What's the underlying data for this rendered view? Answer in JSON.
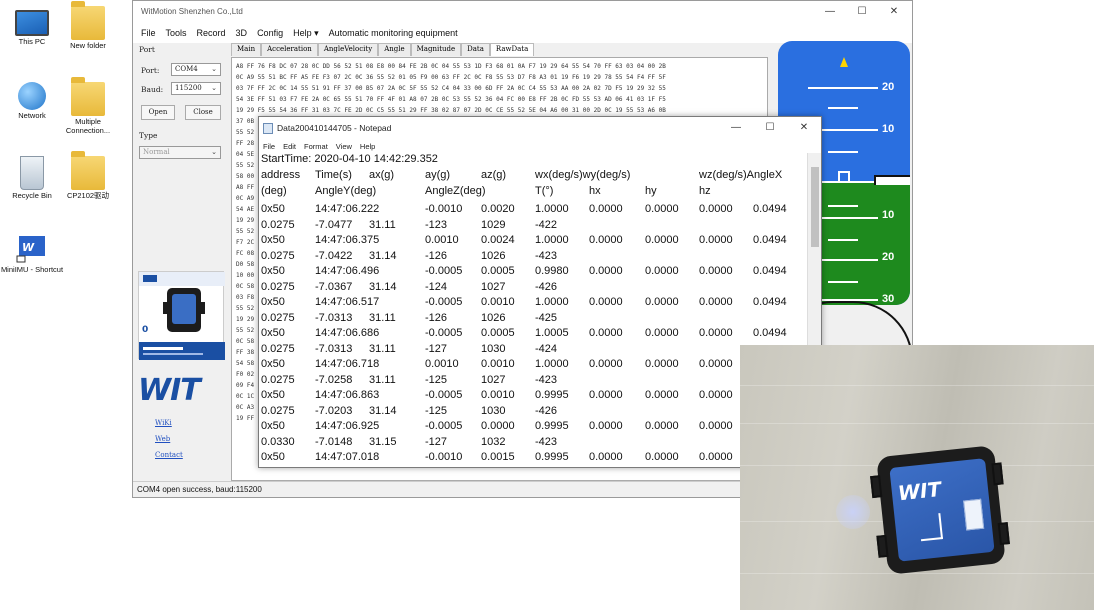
{
  "desktop": {
    "icons": [
      {
        "label": "This PC",
        "icon": "computer-icon"
      },
      {
        "label": "New folder",
        "icon": "folder-icon"
      },
      {
        "label": "Network",
        "icon": "network-icon"
      },
      {
        "label": "Multiple Connection...",
        "icon": "folder-icon"
      },
      {
        "label": "Recycle Bin",
        "icon": "recycle-bin-icon"
      },
      {
        "label": "CP2102驱动",
        "icon": "folder-icon"
      },
      {
        "label": "MiniIMU - Shortcut",
        "icon": "app-shortcut-icon"
      }
    ]
  },
  "app": {
    "title": "WitMotion Shenzhen Co.,Ltd",
    "menu": [
      "File",
      "Tools",
      "Record",
      "3D",
      "Config",
      "Help ▾",
      "Automatic monitoring equipment"
    ],
    "left": {
      "port_section": "Port",
      "port_label": "Port:",
      "port_value": "COM4",
      "baud_label": "Baud:",
      "baud_value": "115200",
      "open_label": "Open",
      "close_label": "Close",
      "type_section": "Type",
      "type_value": "Normal",
      "links": [
        "WiKi",
        "Web",
        "Contact"
      ],
      "logo_text": "WIT"
    },
    "tabs": [
      "Main",
      "Acceleration",
      "AngleVelocity",
      "Angle",
      "Magnitude",
      "Data",
      "RawData"
    ],
    "active_tab": "RawData",
    "hex_lines": [
      "A8 FF 76 F8 DC 07 28 0C DD 56 52 51 08 E8 00 84 FE 2B 0C 04 55 53 1D F3 68 01 0A F7 19 29 64 55 54 70 FF 63 03 04 00 2B",
      "0C A9 55 51 BC FF A5 FE F3 07 2C 0C 36 55 52 01 05 F9 00 63 FF 2C 0C F8 55 53 D7 F8 A3 01 19 F6 19 29 78 55 54 F4 FF 5F",
      "03 7F FF 2C 0C 14 55 51 91 FF 37 00 B5 07 2A 0C 5F 55 52 C4 04 33 00 6D FF 2A 0C C4 55 53 AA 00 2A 02 7D F5 19 29 32 55",
      "54 3E FF 51 03 F7 FE 2A 0C 65 55 51 70 FF 4F 01 A8 07 2B 0C 53 55 52 36 04 FC 00 E8 FF 2B 0C FD 55 53 AD 06 41 03 1F F5",
      "19 29 F5 55 54 36 FF 31 03 7C FE 2D 0C C5 55 51 29 FF 38 02 87 07 2D 0C CE 55 52 5E 04 A6 00 31 00 2D 0C 19 55 53 A6 0B",
      "37 0B",
      "55 52",
      "FF 28",
      "04 5E",
      "55 52",
      "58 00",
      "A8 FF",
      "0C A9",
      "54 AE",
      "19 29",
      "55 52",
      "F7 2C",
      "FC 08",
      "D0 58",
      "10 00",
      "0C 58",
      "03 F8",
      "55 52",
      "19 29",
      "55 52",
      "0C 58",
      "FF 38",
      "54 58",
      "F0 02",
      "09 F4",
      "0C 1C",
      "0C A3",
      "19 FF"
    ],
    "status": "COM4 open success, baud:115200",
    "attitude": {
      "pitch_labels_top": [
        "20",
        "10"
      ],
      "pitch_labels_bottom": [
        "10",
        "20",
        "30"
      ]
    }
  },
  "notepad": {
    "title": "Data200410144705 - Notepad",
    "menu": [
      "File",
      "Edit",
      "Format",
      "View",
      "Help"
    ],
    "start_time": "StartTime: 2020-04-10 14:42:29.352",
    "header1": [
      "address",
      "Time(s)",
      "ax(g)",
      "ay(g)",
      "az(g)",
      "wx(deg/s)wy(deg/s)",
      "wz(deg/s)AngleX"
    ],
    "header2": [
      "(deg)",
      "AngleY(deg)",
      "AngleZ(deg)",
      "T(°)",
      "hx",
      "hy",
      "hz"
    ],
    "rows": [
      {
        "a": [
          "0x50",
          "14:47:06.222",
          "-0.0010",
          "0.0020",
          "1.0000",
          "0.0000",
          "0.0000",
          "0.0000",
          "0.0494"
        ],
        "b": [
          "0.0275",
          "-7.0477",
          "31.11",
          "-123",
          "1029",
          "-422"
        ]
      },
      {
        "a": [
          "0x50",
          "14:47:06.375",
          "0.0010",
          "0.0024",
          "1.0000",
          "0.0000",
          "0.0000",
          "0.0000",
          "0.0494"
        ],
        "b": [
          "0.0275",
          "-7.0422",
          "31.14",
          "-126",
          "1026",
          "-423"
        ]
      },
      {
        "a": [
          "0x50",
          "14:47:06.496",
          "-0.0005",
          "0.0005",
          "0.9980",
          "0.0000",
          "0.0000",
          "0.0000",
          "0.0494"
        ],
        "b": [
          "0.0275",
          "-7.0367",
          "31.14",
          "-124",
          "1027",
          "-426"
        ]
      },
      {
        "a": [
          "0x50",
          "14:47:06.517",
          "-0.0005",
          "0.0010",
          "1.0000",
          "0.0000",
          "0.0000",
          "0.0000",
          "0.0494"
        ],
        "b": [
          "0.0275",
          "-7.0313",
          "31.11",
          "-126",
          "1026",
          "-425"
        ]
      },
      {
        "a": [
          "0x50",
          "14:47:06.686",
          "-0.0005",
          "0.0005",
          "1.0005",
          "0.0000",
          "0.0000",
          "0.0000",
          "0.0494"
        ],
        "b": [
          "0.0275",
          "-7.0313",
          "31.11",
          "-127",
          "1030",
          "-424"
        ]
      },
      {
        "a": [
          "0x50",
          "14:47:06.718",
          "0.0010",
          "0.0010",
          "1.0000",
          "0.0000",
          "0.0000",
          "0.0000",
          ""
        ],
        "b": [
          "0.0275",
          "-7.0258",
          "31.11",
          "-125",
          "1027",
          "-423"
        ]
      },
      {
        "a": [
          "0x50",
          "14:47:06.863",
          "-0.0005",
          "0.0010",
          "0.9995",
          "0.0000",
          "0.0000",
          "0.0000",
          ""
        ],
        "b": [
          "0.0275",
          "-7.0203",
          "31.14",
          "-125",
          "1030",
          "-426"
        ]
      },
      {
        "a": [
          "0x50",
          "14:47:06.925",
          "-0.0005",
          "0.0000",
          "0.9995",
          "0.0000",
          "0.0000",
          "0.0000",
          ""
        ],
        "b": [
          "0.0330",
          "-7.0148",
          "31.15",
          "-127",
          "1032",
          "-423"
        ]
      },
      {
        "a": [
          "0x50",
          "14:47:07.018",
          "-0.0010",
          "0.0015",
          "0.9995",
          "0.0000",
          "0.0000",
          "0.0000",
          ""
        ],
        "b": []
      }
    ]
  },
  "photo": {
    "sensor_brand": "WIT"
  }
}
